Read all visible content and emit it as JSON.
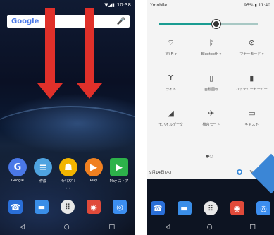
{
  "left": {
    "status_time": "10:38",
    "status_icons": "▼◢▮",
    "search_logo": "Google",
    "mic_icon": "🎤",
    "apps": [
      {
        "label": "Google",
        "glyph": "G",
        "color": "#4a78e8",
        "icon": "google-icon"
      },
      {
        "label": "作成",
        "glyph": "≡",
        "color": "#4fa3e0",
        "icon": "docs-icon"
      },
      {
        "label": "ｷｬﾘｱｱﾌﾟﾘ",
        "glyph": "☗",
        "color": "#f2b400",
        "icon": "carrier-app-icon"
      },
      {
        "label": "Play",
        "glyph": "▶",
        "color": "#f08020",
        "icon": "play-music-icon"
      },
      {
        "label": "Play ストア",
        "glyph": "▶",
        "color": "#2db24a",
        "icon": "play-store-icon"
      }
    ],
    "dock": [
      {
        "glyph": "☎",
        "color": "#2a6fd8",
        "icon": "phone-icon"
      },
      {
        "glyph": "▬",
        "color": "#3a8ee8",
        "icon": "messages-icon"
      },
      {
        "glyph": "⠿",
        "color": "#ffffff",
        "icon": "app-drawer-icon"
      },
      {
        "glyph": "◉",
        "color": "#e04a3a",
        "icon": "chrome-icon"
      },
      {
        "glyph": "◎",
        "color": "#3c8ef0",
        "icon": "camera-icon"
      }
    ],
    "nav": {
      "back": "◁",
      "home": "○",
      "recents": "□"
    }
  },
  "right": {
    "carrier": "Ymobile",
    "status": "95% ▮ 11:40",
    "brightness_level": 0.58,
    "tiles": [
      {
        "label": "Wi-Fi ▾",
        "glyph": "⌔",
        "icon": "wifi-icon"
      },
      {
        "label": "Bluetooth ▾",
        "glyph": "ᛒ",
        "icon": "bluetooth-icon"
      },
      {
        "label": "マナーモード ▾",
        "glyph": "⊘",
        "icon": "silent-mode-icon"
      },
      {
        "label": "ライト",
        "glyph": "ϒ",
        "icon": "flashlight-icon"
      },
      {
        "label": "自動回転",
        "glyph": "▯",
        "icon": "auto-rotate-icon"
      },
      {
        "label": "バッテリーセーバー",
        "glyph": "▮",
        "icon": "battery-saver-icon"
      },
      {
        "label": "モバイルデータ",
        "glyph": "◢",
        "icon": "mobile-data-icon"
      },
      {
        "label": "機内モード",
        "glyph": "✈",
        "icon": "airplane-mode-icon"
      },
      {
        "label": "キャスト",
        "glyph": "▭",
        "icon": "cast-icon"
      }
    ],
    "pager": "●○",
    "date": "9月14日(木)",
    "user_glyph": "●",
    "edit_glyph": "✎",
    "gear_glyph": "⚙",
    "accent": "#e02020"
  }
}
